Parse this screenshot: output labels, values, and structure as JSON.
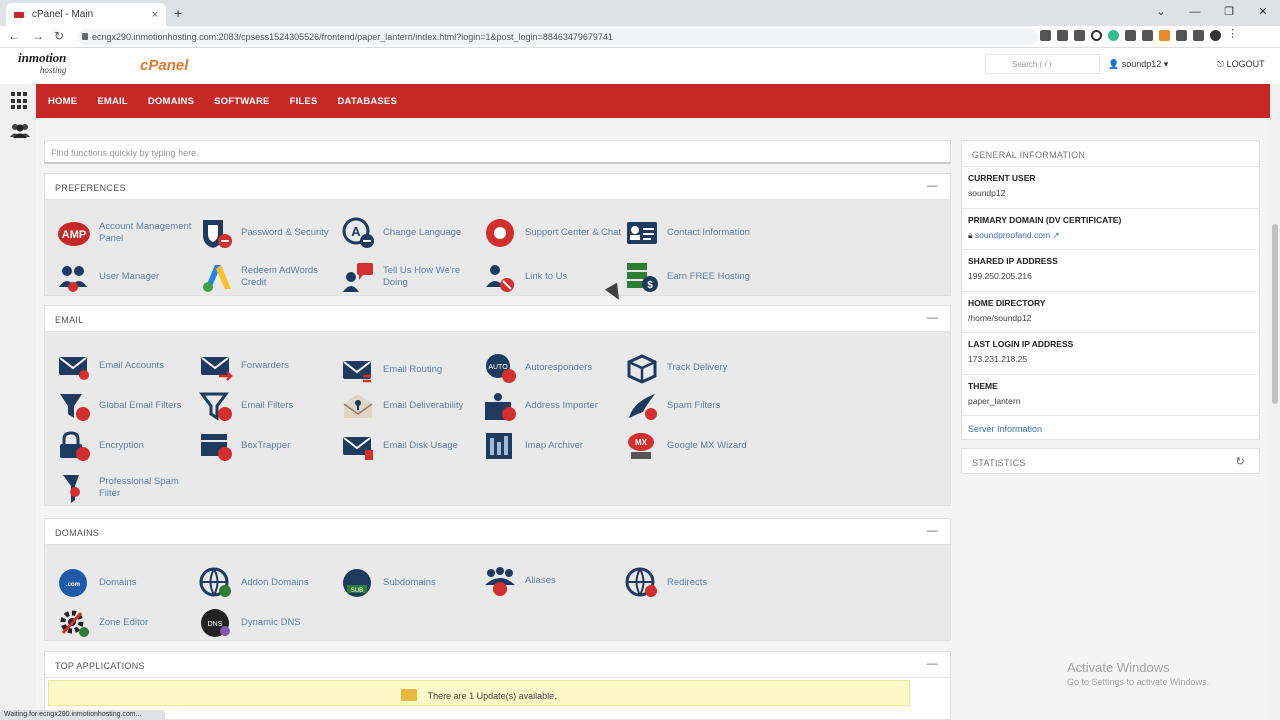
{
  "browser": {
    "tab_title": "cPanel - Main",
    "tab_close": "×",
    "new_tab": "+",
    "url": "ecngx290.inmotionhosting.com:2083/cpsess1524305526/frontend/paper_lantern/index.html?login=1&post_login=88463479679741",
    "status": "Waiting for ecngx290.inmotionhosting.com..."
  },
  "header": {
    "brand_main": "inmotion",
    "brand_sub": "hosting",
    "cpanel_logo": "cPanel",
    "search_placeholder": "Search ( / )",
    "user": "soundp12",
    "logout": "LOGOUT"
  },
  "nav": [
    "HOME",
    "EMAIL",
    "DOMAINS",
    "SOFTWARE",
    "FILES",
    "DATABASES"
  ],
  "main": {
    "search_placeholder": "Find functions quickly by typing here."
  },
  "sections": [
    {
      "title": "PREFERENCES",
      "items": [
        {
          "label": "Account Management Panel",
          "icon": "amp-icon"
        },
        {
          "label": "Password & Security",
          "icon": "password-security-icon"
        },
        {
          "label": "Change Language",
          "icon": "change-language-icon"
        },
        {
          "label": "Support Center & Chat",
          "icon": "support-center-icon"
        },
        {
          "label": "Contact Information",
          "icon": "contact-information-icon"
        },
        {
          "label": "User Manager",
          "icon": "user-manager-icon"
        },
        {
          "label": "Redeem AdWords Credit",
          "icon": "adwords-icon"
        },
        {
          "label": "Tell Us How We're Doing",
          "icon": "feedback-icon"
        },
        {
          "label": "Link to Us",
          "icon": "link-to-us-icon"
        },
        {
          "label": "Earn FREE Hosting",
          "icon": "earn-hosting-icon"
        }
      ]
    },
    {
      "title": "EMAIL",
      "items": [
        {
          "label": "Email Accounts",
          "icon": "email-accounts-icon"
        },
        {
          "label": "Forwarders",
          "icon": "forwarders-icon"
        },
        {
          "label": "Email Routing",
          "icon": "email-routing-icon"
        },
        {
          "label": "Autoresponders",
          "icon": "autoresponders-icon"
        },
        {
          "label": "Track Delivery",
          "icon": "track-delivery-icon"
        },
        {
          "label": "Global Email Filters",
          "icon": "global-email-filters-icon"
        },
        {
          "label": "Email Filters",
          "icon": "email-filters-icon"
        },
        {
          "label": "Email Deliverability",
          "icon": "email-deliverability-icon"
        },
        {
          "label": "Address Importer",
          "icon": "address-importer-icon"
        },
        {
          "label": "Spam Filters",
          "icon": "spam-filters-icon"
        },
        {
          "label": "Encryption",
          "icon": "encryption-icon"
        },
        {
          "label": "BoxTrapper",
          "icon": "boxtrapper-icon"
        },
        {
          "label": "Email Disk Usage",
          "icon": "email-disk-usage-icon"
        },
        {
          "label": "Imap Archiver",
          "icon": "imap-archiver-icon"
        },
        {
          "label": "Google MX Wizard",
          "icon": "google-mx-wizard-icon"
        },
        {
          "label": "Professional Spam Filter",
          "icon": "professional-spam-filter-icon"
        }
      ]
    },
    {
      "title": "DOMAINS",
      "items": [
        {
          "label": "Domains",
          "icon": "domains-icon"
        },
        {
          "label": "Addon Domains",
          "icon": "addon-domains-icon"
        },
        {
          "label": "Subdomains",
          "icon": "subdomains-icon"
        },
        {
          "label": "Aliases",
          "icon": "aliases-icon"
        },
        {
          "label": "Redirects",
          "icon": "redirects-icon"
        },
        {
          "label": "Zone Editor",
          "icon": "zone-editor-icon"
        },
        {
          "label": "Dynamic DNS",
          "icon": "dynamic-dns-icon"
        }
      ]
    },
    {
      "title": "TOP APPLICATIONS",
      "items": []
    }
  ],
  "updates_notice": "There are 1 Update(s) available.",
  "general_info": {
    "title": "GENERAL INFORMATION",
    "rows": [
      {
        "key": "CURRENT USER",
        "value": "soundp12"
      },
      {
        "key": "PRIMARY DOMAIN (DV CERTIFICATE)",
        "value": "soundproofand.com"
      },
      {
        "key": "SHARED IP ADDRESS",
        "value": "199.250.205.216"
      },
      {
        "key": "HOME DIRECTORY",
        "value": "/home/soundp12"
      },
      {
        "key": "LAST LOGIN IP ADDRESS",
        "value": "173.231.218.25"
      },
      {
        "key": "THEME",
        "value": "paper_lantern"
      }
    ],
    "link": "Server Information"
  },
  "statistics": {
    "title": "STATISTICS"
  },
  "watermark": {
    "line1": "Activate Windows",
    "line2": "Go to Settings to activate Windows."
  },
  "colors": {
    "nav_red": "#c62828",
    "link_blue": "#5a7fa8",
    "icon_navy": "#1e3a5f",
    "badge_red": "#d32f2f"
  }
}
